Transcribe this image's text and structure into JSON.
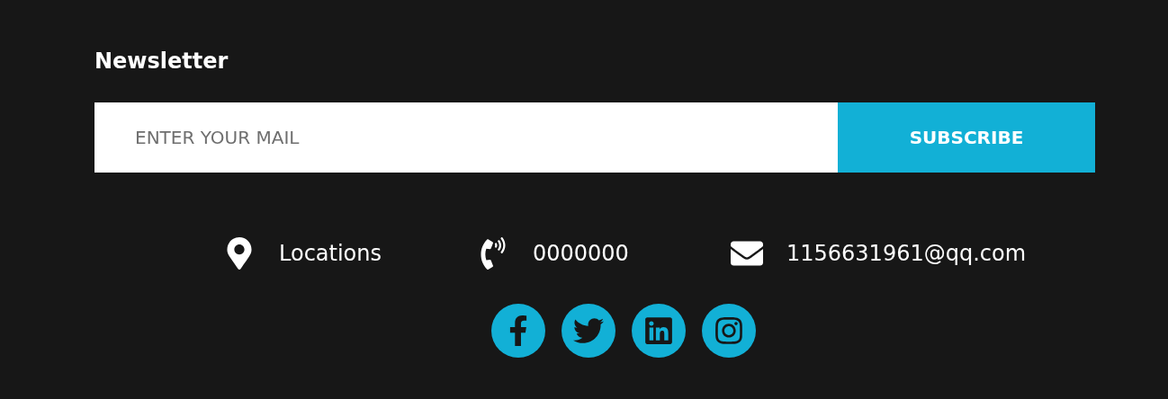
{
  "newsletter": {
    "title": "Newsletter",
    "email_field": {
      "placeholder": "ENTER YOUR MAIL"
    },
    "subscribe_button": "SUBSCRIBE"
  },
  "contacts": [
    {
      "kind": "location",
      "text": "Locations"
    },
    {
      "kind": "phone",
      "text": "0000000"
    },
    {
      "kind": "email",
      "text": "1156631961@qq.com"
    }
  ],
  "social": [
    {
      "kind": "facebook"
    },
    {
      "kind": "twitter"
    },
    {
      "kind": "linkedin"
    },
    {
      "kind": "instagram"
    }
  ]
}
